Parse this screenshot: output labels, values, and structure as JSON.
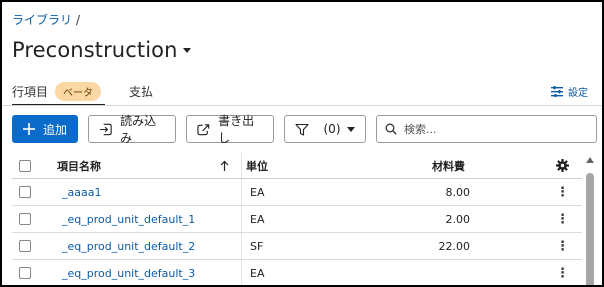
{
  "breadcrumb": {
    "root": "ライブラリ",
    "separator": "/"
  },
  "page": {
    "title": "Preconstruction"
  },
  "tabs": [
    {
      "label": "行項目",
      "badge": "ベータ",
      "active": true
    },
    {
      "label": "支払",
      "active": false
    }
  ],
  "settings": {
    "label": "設定"
  },
  "toolbar": {
    "add_label": "追加",
    "import_label": "読み込み",
    "export_label": "書き出し",
    "filter_count": "(0)"
  },
  "search": {
    "placeholder": "検索..."
  },
  "table": {
    "columns": {
      "name": "項目名称",
      "unit": "単位",
      "cost": "材料費"
    },
    "rows": [
      {
        "name": "_aaaa1",
        "unit": "EA",
        "cost": "8.00"
      },
      {
        "name": "_eq_prod_unit_default_1",
        "unit": "EA",
        "cost": "2.00"
      },
      {
        "name": "_eq_prod_unit_default_2",
        "unit": "SF",
        "cost": "22.00"
      },
      {
        "name": "_eq_prod_unit_default_3",
        "unit": "EA",
        "cost": ""
      }
    ]
  },
  "colors": {
    "primary": "#0a6cc8",
    "link": "#0a5ba8",
    "beta_badge": "#fbd7a3"
  }
}
